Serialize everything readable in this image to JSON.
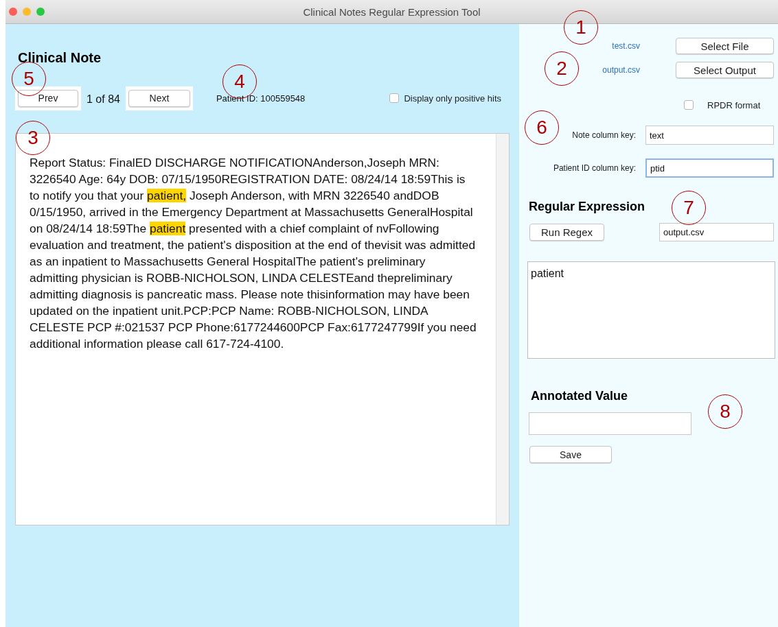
{
  "window": {
    "title": "Clinical Notes Regular Expression Tool"
  },
  "note_panel": {
    "heading": "Clinical Note",
    "prev_button": "Prev",
    "position": "1 of 84",
    "next_button": "Next",
    "patient_id": "Patient ID: 100559548",
    "positive_hits": {
      "label": "Display only positive hits",
      "checked": false
    },
    "note_text": [
      {
        "text": "Report Status: FinalED DISCHARGE NOTIFICATIONAnderson,Joseph MRN: 3226540 Age: 64y DOB: 07/15/1950REGISTRATION DATE: 08/24/14 18:59This is to notify you that your ",
        "highlighted": false
      },
      {
        "text": "patient,",
        "highlighted": true
      },
      {
        "text": " Joseph Anderson, with MRN 3226540 andDOB 0/15/1950, arrived in the Emergency Department at Massachusetts GeneralHospital on 08/24/14 18:59The ",
        "highlighted": false
      },
      {
        "text": "patient",
        "highlighted": true
      },
      {
        "text": " presented with a chief complaint of nvFollowing evaluation and treatment, the patient's disposition at the end of thevisit was admitted as an inpatient to Massachusetts General HospitalThe patient's preliminary admitting physician is ROBB-NICHOLSON, LINDA CELESTEand thepreliminary admitting diagnosis is pancreatic mass. Please note thisinformation may have been updated on the inpatient unit.PCP:PCP Name: ROBB-NICHOLSON, LINDA CELESTE PCP #:021537 PCP Phone:6177244600PCP Fax:6177247799If you need additional information please call 617-724-4100.",
        "highlighted": false
      }
    ]
  },
  "side_panel": {
    "input_file": "test.csv",
    "select_file_button": "Select File",
    "output_file": "output.csv",
    "select_output_button": "Select Output",
    "rpdr_format": {
      "label": "RPDR format",
      "checked": false
    },
    "note_column_key": {
      "label": "Note column key:",
      "value": "text",
      "focused": false
    },
    "patient_id_column_key": {
      "label": "Patient ID column key:",
      "value": "ptid",
      "focused": true
    },
    "regex_heading": "Regular Expression",
    "run_regex_button": "Run Regex",
    "regex_output": {
      "value": "output.csv"
    },
    "regex": {
      "value": "patient"
    },
    "annotated_heading": "Annotated Value",
    "save_button": "Save"
  },
  "callouts": [
    "1",
    "2",
    "3",
    "4",
    "5",
    "6",
    "7",
    "8"
  ]
}
